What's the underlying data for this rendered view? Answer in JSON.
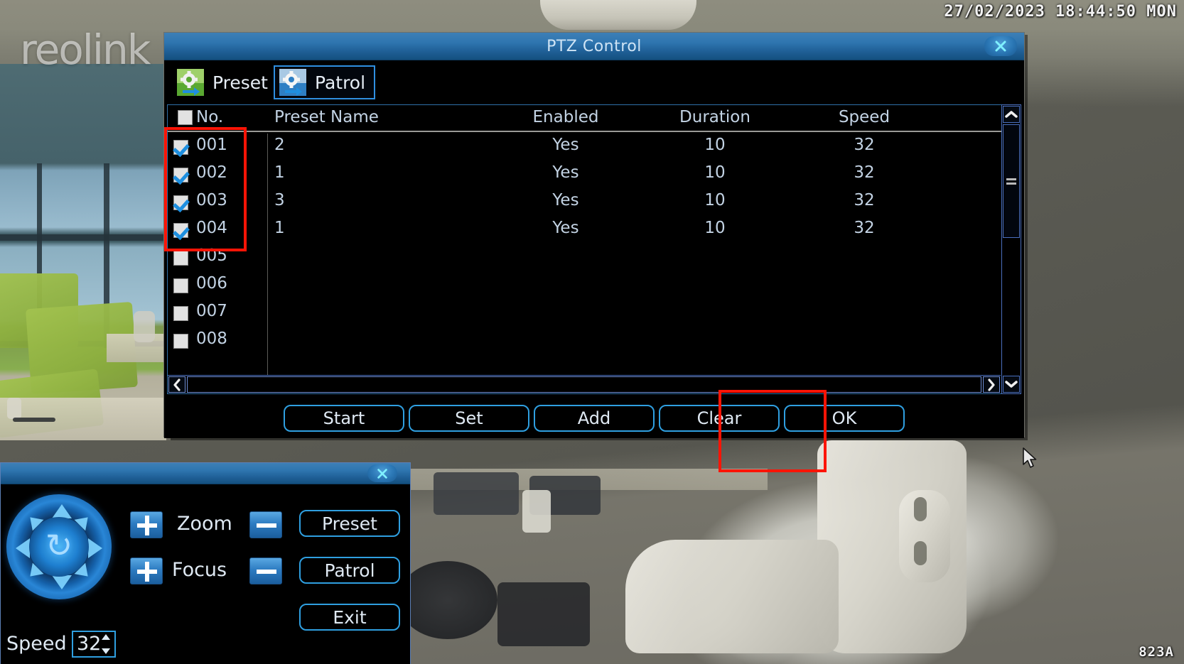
{
  "osd": {
    "datetime": "27/02/2023  18:44:50  MON",
    "channel_id": "823A",
    "watermark": "reolink"
  },
  "ptz_dialog": {
    "title": "PTZ Control",
    "close_icon": "close-icon",
    "tabs": [
      {
        "label": "Preset",
        "icon": "preset-gear-arrow-icon",
        "active": false
      },
      {
        "label": "Patrol",
        "icon": "patrol-gear-arrow-icon",
        "active": true
      }
    ],
    "table": {
      "headers": {
        "check": "",
        "no": "No.",
        "name": "Preset Name",
        "enabled": "Enabled",
        "duration": "Duration",
        "speed": "Speed"
      },
      "header_checked": false,
      "rows": [
        {
          "checked": true,
          "no": "001",
          "name": "2",
          "enabled": "Yes",
          "duration": "10",
          "speed": "32"
        },
        {
          "checked": true,
          "no": "002",
          "name": "1",
          "enabled": "Yes",
          "duration": "10",
          "speed": "32"
        },
        {
          "checked": true,
          "no": "003",
          "name": "3",
          "enabled": "Yes",
          "duration": "10",
          "speed": "32"
        },
        {
          "checked": true,
          "no": "004",
          "name": "1",
          "enabled": "Yes",
          "duration": "10",
          "speed": "32"
        },
        {
          "checked": false,
          "no": "005",
          "name": "",
          "enabled": "",
          "duration": "",
          "speed": ""
        },
        {
          "checked": false,
          "no": "006",
          "name": "",
          "enabled": "",
          "duration": "",
          "speed": ""
        },
        {
          "checked": false,
          "no": "007",
          "name": "",
          "enabled": "",
          "duration": "",
          "speed": ""
        },
        {
          "checked": false,
          "no": "008",
          "name": "",
          "enabled": "",
          "duration": "",
          "speed": ""
        }
      ]
    },
    "scrollbars": {
      "v_up_icon": "chevron-up-icon",
      "v_down_icon": "chevron-down-icon",
      "h_left_icon": "chevron-left-icon",
      "h_right_icon": "chevron-right-icon"
    },
    "footer_buttons": [
      {
        "label": "Start"
      },
      {
        "label": "Set"
      },
      {
        "label": "Add"
      },
      {
        "label": "Clear"
      },
      {
        "label": "OK"
      }
    ]
  },
  "ptz_panel": {
    "close_icon": "close-icon",
    "joystick": {
      "name": "direction-pad",
      "rotate_icon": "auto-rotate-icon"
    },
    "zoom": {
      "label": "Zoom",
      "plus": "+",
      "minus": "−"
    },
    "focus": {
      "label": "Focus",
      "plus": "+",
      "minus": "−"
    },
    "buttons": [
      {
        "label": "Preset"
      },
      {
        "label": "Patrol"
      },
      {
        "label": "Exit"
      }
    ],
    "speed": {
      "label": "Speed",
      "value": "32"
    }
  },
  "annotations": {
    "rows_highlight": "red-box-rows-001-004",
    "clear_highlight": "red-box-clear-button"
  },
  "colors": {
    "accent_blue": "#2f9fe0",
    "title_blue": "#2f76b0",
    "annotation_red": "#fc1406",
    "text_light": "#dfe9f3"
  }
}
